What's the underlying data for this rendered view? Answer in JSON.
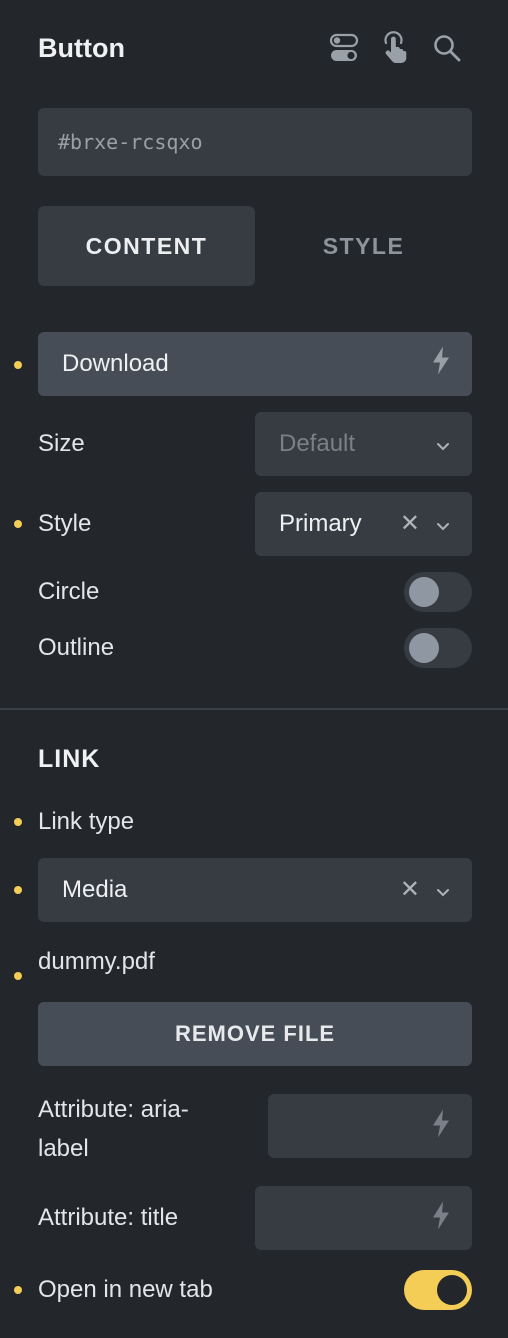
{
  "panel": {
    "title": "Button",
    "element_id": "#brxe-rcsqxo",
    "header_icons": [
      "toggle-view-icon",
      "hand-pointer-icon",
      "search-icon"
    ]
  },
  "tabs": [
    {
      "label": "CONTENT",
      "active": true
    },
    {
      "label": "STYLE",
      "active": false
    }
  ],
  "content": {
    "text_value": "Download",
    "size": {
      "label": "Size",
      "placeholder": "Default"
    },
    "style": {
      "label": "Style",
      "value": "Primary"
    },
    "circle": {
      "label": "Circle",
      "on": false
    },
    "outline": {
      "label": "Outline",
      "on": false
    }
  },
  "link": {
    "section_title": "LINK",
    "link_type_label": "Link type",
    "link_type_value": "Media",
    "file_name": "dummy.pdf",
    "remove_file_label": "REMOVE FILE",
    "aria_label_line1": "Attribute: aria-",
    "aria_label_line2": "label",
    "title_attr_label": "Attribute: title",
    "new_tab_label": "Open in new tab",
    "new_tab_on": true
  },
  "colors": {
    "background": "#23262b",
    "field": "#373b42",
    "field_active": "#464d57",
    "accent": "#f3cd55"
  }
}
